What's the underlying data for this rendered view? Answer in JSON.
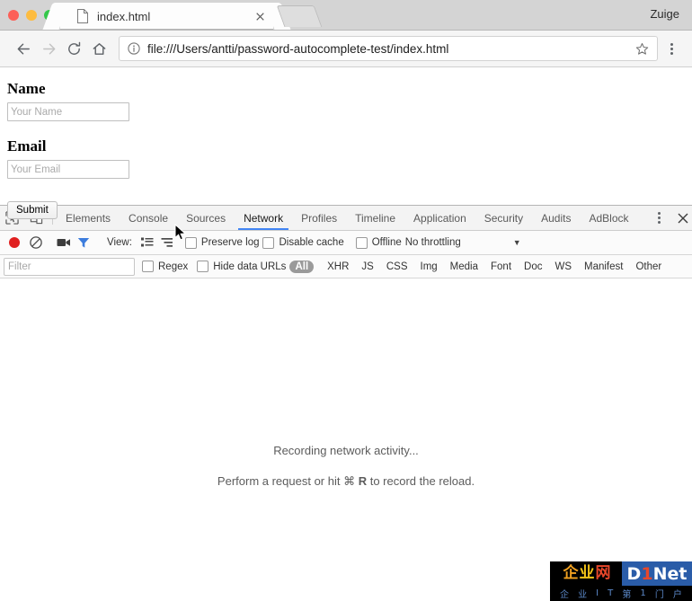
{
  "browser": {
    "tab": {
      "title": "index.html",
      "favicon_icon": "document-icon",
      "close_icon": "close-icon"
    },
    "new_tab_icon": "new-tab-icon",
    "profile_name": "Zuige",
    "toolbar": {
      "back_icon": "back-arrow-icon",
      "forward_icon": "forward-arrow-icon",
      "reload_icon": "reload-icon",
      "home_icon": "home-icon",
      "info_icon": "info-circle-icon",
      "url": "file:///Users/antti/password-autocomplete-test/index.html",
      "bookmark_icon": "star-icon",
      "menu_icon": "kebab-menu-icon"
    },
    "traffic_lights": {
      "close_color": "#fc6058",
      "minimize_color": "#fdbc40",
      "maximize_color": "#34c84a"
    }
  },
  "page": {
    "name_label": "Name",
    "name_placeholder": "Your Name",
    "name_value": "",
    "email_label": "Email",
    "email_placeholder": "Your Email",
    "email_value": "",
    "submit_label": "Submit",
    "cursor_icon": "mouse-pointer-icon"
  },
  "devtools": {
    "inspect_icon": "inspect-element-icon",
    "device_icon": "device-toolbar-icon",
    "tabs": [
      {
        "label": "Elements",
        "active": false
      },
      {
        "label": "Console",
        "active": false
      },
      {
        "label": "Sources",
        "active": false
      },
      {
        "label": "Network",
        "active": true
      },
      {
        "label": "Profiles",
        "active": false
      },
      {
        "label": "Timeline",
        "active": false
      },
      {
        "label": "Application",
        "active": false
      },
      {
        "label": "Security",
        "active": false
      },
      {
        "label": "Audits",
        "active": false
      },
      {
        "label": "AdBlock",
        "active": false
      }
    ],
    "more_icon": "kebab-menu-icon",
    "close_icon": "close-icon",
    "active_tab_underline_color": "#4285f4",
    "network_toolbar": {
      "record_icon": "record-circle-icon",
      "record_color": "#e02020",
      "clear_icon": "clear-no-entry-icon",
      "screenshot_icon": "camera-icon",
      "filter_icon": "funnel-icon",
      "filter_icon_color": "#3d7ddd",
      "view_label": "View:",
      "view_list_icon": "list-view-icon",
      "view_waterfall_icon": "waterfall-view-icon",
      "preserve_log_label": "Preserve log",
      "preserve_log_checked": false,
      "disable_cache_label": "Disable cache",
      "disable_cache_checked": false,
      "offline_label": "Offline",
      "offline_checked": false,
      "throttling_value": "No throttling",
      "throttling_arrow_icon": "chevron-down-icon"
    },
    "filter_bar": {
      "filter_placeholder": "Filter",
      "filter_value": "",
      "regex_label": "Regex",
      "regex_checked": false,
      "hide_data_urls_label": "Hide data URLs",
      "hide_data_urls_checked": false,
      "types": [
        {
          "label": "All",
          "selected": true
        },
        {
          "label": "XHR",
          "selected": false
        },
        {
          "label": "JS",
          "selected": false
        },
        {
          "label": "CSS",
          "selected": false
        },
        {
          "label": "Img",
          "selected": false
        },
        {
          "label": "Media",
          "selected": false
        },
        {
          "label": "Font",
          "selected": false
        },
        {
          "label": "Doc",
          "selected": false
        },
        {
          "label": "WS",
          "selected": false
        },
        {
          "label": "Manifest",
          "selected": false
        },
        {
          "label": "Other",
          "selected": false
        }
      ]
    },
    "empty_state": {
      "line1": "Recording network activity...",
      "line2_prefix": "Perform a request or hit ",
      "line2_cmd": "⌘",
      "line2_key": "R",
      "line2_suffix": " to record the reload."
    }
  },
  "watermark": {
    "cn_char1": "企",
    "cn_char2": "业",
    "cn_char3": "网",
    "brand_d": "D",
    "brand_1": "1",
    "brand_net": "Net",
    "tagline": [
      "企",
      "业",
      "I",
      "T",
      "第",
      "1",
      "门",
      "户"
    ],
    "bg_color": "#000000",
    "brand_bg_color": "#2a5ca8"
  }
}
